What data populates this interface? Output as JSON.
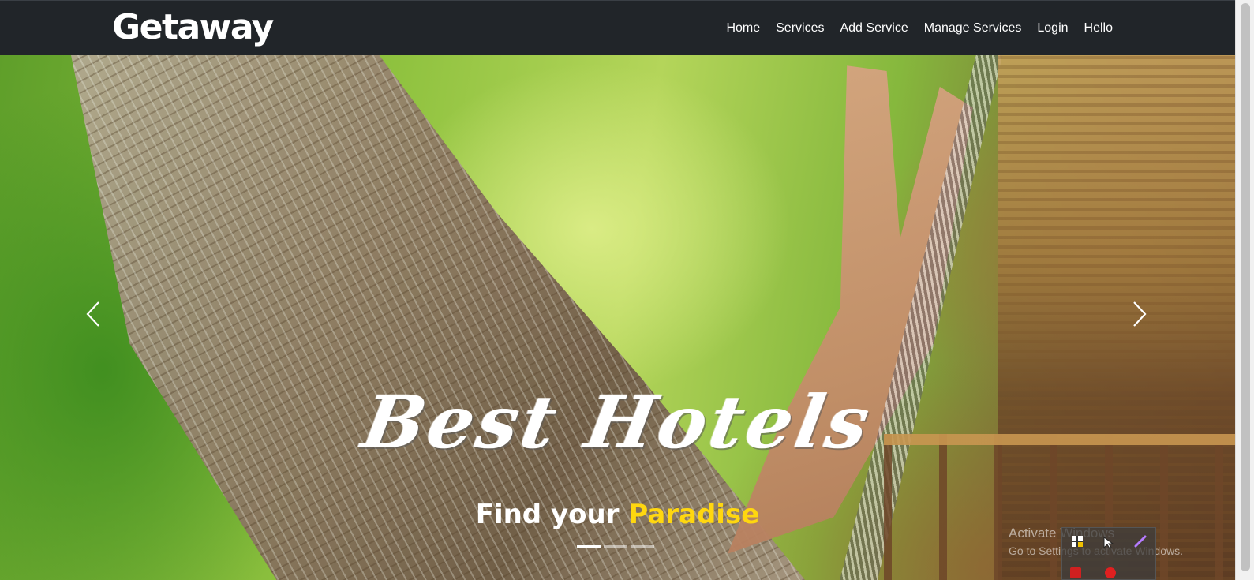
{
  "brand": {
    "name": "Getaway"
  },
  "nav": {
    "items": [
      {
        "label": "Home"
      },
      {
        "label": "Services"
      },
      {
        "label": "Add Service"
      },
      {
        "label": "Manage Services"
      },
      {
        "label": "Login"
      },
      {
        "label": "Hello"
      }
    ]
  },
  "hero": {
    "title": "Best Hotels",
    "subtitle_part1": "Find your ",
    "subtitle_part2": "Paradise",
    "accent_color": "#ffd70f",
    "indicators_count": 3,
    "active_indicator": 1
  },
  "watermark": {
    "title": "Activate Windows",
    "subtitle": "Go to Settings to activate Windows."
  },
  "colors": {
    "navbar_bg": "#212529",
    "text": "#ffffff"
  }
}
